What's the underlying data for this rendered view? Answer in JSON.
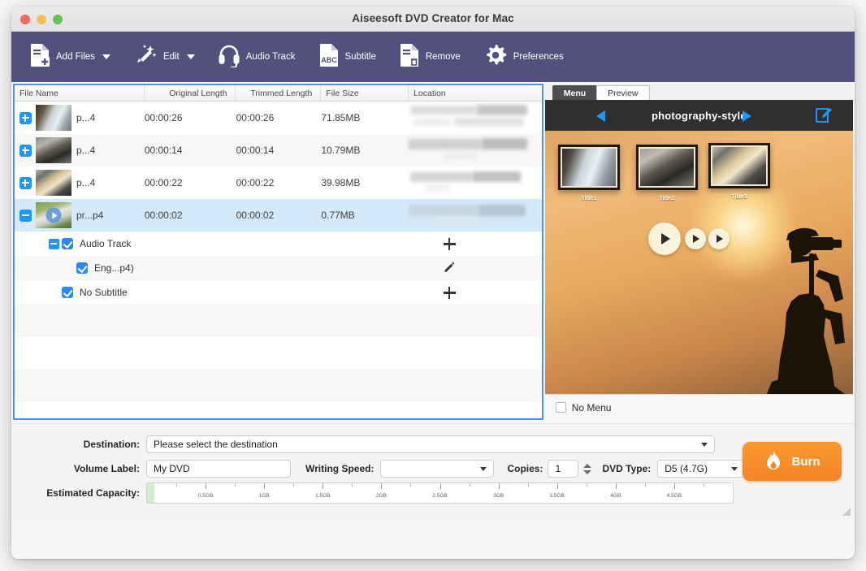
{
  "window": {
    "title": "Aiseesoft DVD Creator for Mac",
    "traffic_lights": [
      "close-red",
      "minimize-yellow",
      "maximize-green"
    ]
  },
  "toolbar": {
    "accent_color": "#52517e",
    "items": [
      {
        "label": "Add Files",
        "icon": "add-files-icon",
        "has_caret": true
      },
      {
        "label": "Edit",
        "icon": "magic-wand-icon",
        "has_caret": true
      },
      {
        "label": "Audio Track",
        "icon": "headphones-icon",
        "has_caret": false
      },
      {
        "label": "Subtitle",
        "icon": "abc-subtitle-icon",
        "has_caret": false
      },
      {
        "label": "Remove",
        "icon": "remove-file-icon",
        "has_caret": false
      },
      {
        "label": "Preferences",
        "icon": "gear-icon",
        "has_caret": false
      }
    ]
  },
  "file_list": {
    "columns": [
      "File Name",
      "Original Length",
      "Trimmed Length",
      "File Size",
      "Location"
    ],
    "rows": [
      {
        "expander": "plus",
        "name": "p...4",
        "original_length": "00:00:26",
        "trimmed_length": "00:00:26",
        "file_size": "71.85MB",
        "location": "redacted",
        "selected": false
      },
      {
        "expander": "plus",
        "name": "p...4",
        "original_length": "00:00:14",
        "trimmed_length": "00:00:14",
        "file_size": "10.79MB",
        "location": "redacted",
        "selected": false
      },
      {
        "expander": "plus",
        "name": "p...4",
        "original_length": "00:00:22",
        "trimmed_length": "00:00:22",
        "file_size": "39.98MB",
        "location": "redacted",
        "selected": false
      },
      {
        "expander": "minus",
        "name": "pr...p4",
        "original_length": "00:00:02",
        "trimmed_length": "00:00:02",
        "file_size": "0.77MB",
        "location": "redacted",
        "selected": true
      }
    ],
    "sub_rows": [
      {
        "label": "Audio Track",
        "checked": true,
        "has_expander": true,
        "indent": 0,
        "action": "add-plus-icon"
      },
      {
        "label": "Eng...p4)",
        "checked": true,
        "has_expander": false,
        "indent": 1,
        "action": "pencil-edit-icon"
      },
      {
        "label": "No Subtitle",
        "checked": true,
        "has_expander": false,
        "indent": 0,
        "action": "add-plus-icon"
      }
    ]
  },
  "right_panel": {
    "tabs": [
      {
        "label": "Menu",
        "active": true
      },
      {
        "label": "Preview",
        "active": false
      }
    ],
    "menu_template": {
      "name": "photography-style",
      "prev_label": "previous-template",
      "next_label": "next-template",
      "edit_label": "edit-menu"
    },
    "thumbnails": [
      {
        "title": "Title1"
      },
      {
        "title": "Title2"
      },
      {
        "title": "Title3"
      }
    ],
    "play_buttons": [
      "play-all",
      "play-1",
      "play-2"
    ],
    "no_menu": {
      "label": "No Menu",
      "checked": false
    }
  },
  "bottom": {
    "destination": {
      "label": "Destination:",
      "value": "Please select the destination"
    },
    "volume": {
      "label": "Volume Label:",
      "value": "My DVD"
    },
    "writing_speed": {
      "label": "Writing Speed:",
      "value": ""
    },
    "copies": {
      "label": "Copies:",
      "value": "1"
    },
    "dvd_type": {
      "label": "DVD Type:",
      "value": "D5 (4.7G)"
    },
    "capacity": {
      "label": "Estimated Capacity:",
      "fill_percent": 1.2,
      "ticks": [
        "0.5GB",
        "1GB",
        "1.5GB",
        "2GB",
        "2.5GB",
        "3GB",
        "3.5GB",
        "4GB",
        "4.5GB"
      ]
    },
    "burn_button": {
      "label": "Burn",
      "icon": "flame-icon",
      "color": "#f5832a"
    }
  }
}
